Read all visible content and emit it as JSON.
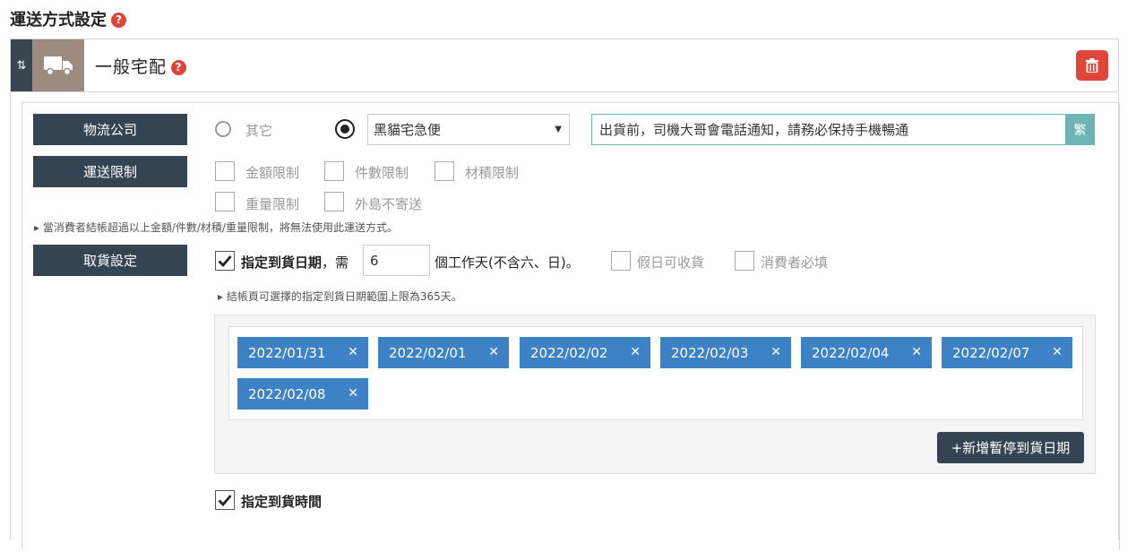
{
  "page": {
    "title": "運送方式設定",
    "help_icon": "?"
  },
  "method": {
    "name": "一般宅配",
    "help_icon": "?",
    "drag_glyph": "⇅"
  },
  "logistics": {
    "label": "物流公司",
    "option_other": "其它",
    "selected_carrier": "黑貓宅急便",
    "note_value": "出貨前，司機大哥會電話通知，請務必保持手機暢通",
    "convert_button": "繁"
  },
  "restrictions": {
    "label": "運送限制",
    "options": [
      "金額限制",
      "件數限制",
      "材積限制",
      "重量限制",
      "外島不寄送"
    ],
    "hint": "▸ 當消費者結帳超過以上金額/件數/材積/重量限制，將無法使用此運送方式。"
  },
  "pickup": {
    "label": "取貨設定",
    "specify_date_label": "指定到貨日期",
    "need_text": "，需",
    "days_value": "6",
    "days_suffix": "個工作天(不含六、日)。",
    "holiday_label": "假日可收貨",
    "consumer_required_label": "消費者必填",
    "range_hint": "▸ 結帳頁可選擇的指定到貨日期範圍上限為365天。",
    "paused_dates": [
      "2022/01/31",
      "2022/02/01",
      "2022/02/02",
      "2022/02/03",
      "2022/02/04",
      "2022/02/07",
      "2022/02/08"
    ],
    "remove_glyph": "✕",
    "add_date_button": "+新增暫停到貨日期",
    "specify_time_label": "指定到貨時間"
  },
  "colors": {
    "accent_blue": "#3e82c6",
    "dark_navy": "#354452",
    "danger": "#e0453a",
    "teal": "#6db5b5"
  }
}
